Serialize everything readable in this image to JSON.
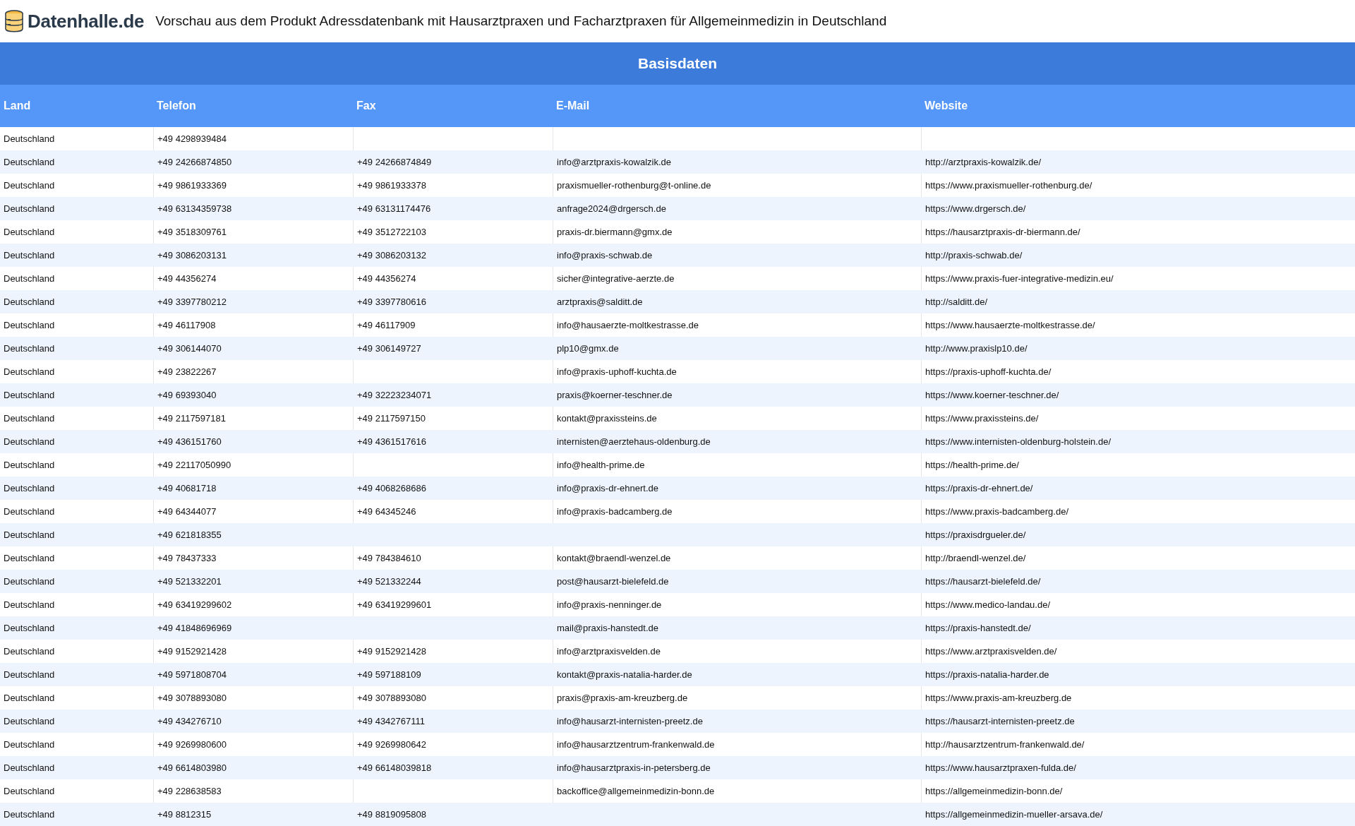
{
  "header": {
    "logo_text": "Datenhalle.de",
    "title": "Vorschau aus dem Produkt Adressdatenbank mit Hausarztpraxen und Facharztpraxen für Allgemeinmedizin in Deutschland"
  },
  "table": {
    "banner": "Basisdaten",
    "columns": [
      "Land",
      "Telefon",
      "Fax",
      "E-Mail",
      "Website"
    ],
    "rows": [
      {
        "land": "Deutschland",
        "telefon": "+49 4298939484"
      },
      {
        "land": "Deutschland",
        "telefon": "+49 24266874850",
        "fax": "+49 24266874849",
        "email": "info@arztpraxis-kowalzik.de",
        "website": "http://arztpraxis-kowalzik.de/"
      },
      {
        "land": "Deutschland",
        "telefon": "+49 9861933369",
        "fax": "+49 9861933378",
        "email": "praxismueller-rothenburg@t-online.de",
        "website": "https://www.praxismueller-rothenburg.de/"
      },
      {
        "land": "Deutschland",
        "telefon": "+49 63134359738",
        "fax": "+49 63131174476",
        "email": "anfrage2024@drgersch.de",
        "website": "https://www.drgersch.de/"
      },
      {
        "land": "Deutschland",
        "telefon": "+49 3518309761",
        "fax": "+49 3512722103",
        "email": "praxis-dr.biermann@gmx.de",
        "website": "https://hausarztpraxis-dr-biermann.de/"
      },
      {
        "land": "Deutschland",
        "telefon": "+49 3086203131",
        "fax": "+49 3086203132",
        "email": "info@praxis-schwab.de",
        "website": "http://praxis-schwab.de/"
      },
      {
        "land": "Deutschland",
        "telefon": "+49 44356274",
        "fax": "+49 44356274",
        "email": "sicher@integrative-aerzte.de",
        "website": "https://www.praxis-fuer-integrative-medizin.eu/"
      },
      {
        "land": "Deutschland",
        "telefon": "+49 3397780212",
        "fax": "+49 3397780616",
        "email": "arztpraxis@salditt.de",
        "website": "http://salditt.de/"
      },
      {
        "land": "Deutschland",
        "telefon": "+49 46117908",
        "fax": "+49 46117909",
        "email": "info@hausaerzte-moltkestrasse.de",
        "website": "https://www.hausaerzte-moltkestrasse.de/"
      },
      {
        "land": "Deutschland",
        "telefon": "+49 306144070",
        "fax": "+49 306149727",
        "email": "plp10@gmx.de",
        "website": "http://www.praxislp10.de/"
      },
      {
        "land": "Deutschland",
        "telefon": "+49 23822267",
        "email": "info@praxis-uphoff-kuchta.de",
        "website": "https://praxis-uphoff-kuchta.de/"
      },
      {
        "land": "Deutschland",
        "telefon": "+49 69393040",
        "fax": "+49 32223234071",
        "email": "praxis@koerner-teschner.de",
        "website": "https://www.koerner-teschner.de/"
      },
      {
        "land": "Deutschland",
        "telefon": "+49 2117597181",
        "fax": "+49 2117597150",
        "email": "kontakt@praxissteins.de",
        "website": "https://www.praxissteins.de/"
      },
      {
        "land": "Deutschland",
        "telefon": "+49 436151760",
        "fax": "+49 4361517616",
        "email": "internisten@aerztehaus-oldenburg.de",
        "website": "https://www.internisten-oldenburg-holstein.de/"
      },
      {
        "land": "Deutschland",
        "telefon": "+49 22117050990",
        "email": "info@health-prime.de",
        "website": "https://health-prime.de/"
      },
      {
        "land": "Deutschland",
        "telefon": "+49 40681718",
        "fax": "+49 4068268686",
        "email": "info@praxis-dr-ehnert.de",
        "website": "https://praxis-dr-ehnert.de/"
      },
      {
        "land": "Deutschland",
        "telefon": "+49 64344077",
        "fax": "+49 64345246",
        "email": "info@praxis-badcamberg.de",
        "website": "https://www.praxis-badcamberg.de/"
      },
      {
        "land": "Deutschland",
        "telefon": "+49 621818355",
        "website": "https://praxisdrgueler.de/"
      },
      {
        "land": "Deutschland",
        "telefon": "+49 78437333",
        "fax": "+49 784384610",
        "email": "kontakt@braendl-wenzel.de",
        "website": "http://braendl-wenzel.de/"
      },
      {
        "land": "Deutschland",
        "telefon": "+49 521332201",
        "fax": "+49 521332244",
        "email": "post@hausarzt-bielefeld.de",
        "website": "https://hausarzt-bielefeld.de/"
      },
      {
        "land": "Deutschland",
        "telefon": "+49 63419299602",
        "fax": "+49 63419299601",
        "email": "info@praxis-nenninger.de",
        "website": "https://www.medico-landau.de/"
      },
      {
        "land": "Deutschland",
        "telefon": "+49 41848696969",
        "email": "mail@praxis-hanstedt.de",
        "website": "https://praxis-hanstedt.de/"
      },
      {
        "land": "Deutschland",
        "telefon": "+49 9152921428",
        "fax": "+49 9152921428",
        "email": "info@arztpraxisvelden.de",
        "website": "https://www.arztpraxisvelden.de/"
      },
      {
        "land": "Deutschland",
        "telefon": "+49 5971808704",
        "fax": "+49 597188109",
        "email": "kontakt@praxis-natalia-harder.de",
        "website": "https://praxis-natalia-harder.de"
      },
      {
        "land": "Deutschland",
        "telefon": "+49 3078893080",
        "fax": "+49 3078893080",
        "email": "praxis@praxis-am-kreuzberg.de",
        "website": "https://www.praxis-am-kreuzberg.de"
      },
      {
        "land": "Deutschland",
        "telefon": "+49 434276710",
        "fax": "+49 4342767111",
        "email": "info@hausarzt-internisten-preetz.de",
        "website": "https://hausarzt-internisten-preetz.de"
      },
      {
        "land": "Deutschland",
        "telefon": "+49 9269980600",
        "fax": "+49 9269980642",
        "email": "info@hausarztzentrum-frankenwald.de",
        "website": "http://hausarztzentrum-frankenwald.de/"
      },
      {
        "land": "Deutschland",
        "telefon": "+49 6614803980",
        "fax": "+49 66148039818",
        "email": "info@hausarztpraxis-in-petersberg.de",
        "website": "https://www.hausarztpraxen-fulda.de/"
      },
      {
        "land": "Deutschland",
        "telefon": "+49 228638583",
        "email": "backoffice@allgemeinmedizin-bonn.de",
        "website": "https://allgemeinmedizin-bonn.de/"
      },
      {
        "land": "Deutschland",
        "telefon": "+49 8812315",
        "fax": "+49 8819095808",
        "website": "https://allgemeinmedizin-mueller-arsava.de/"
      }
    ]
  }
}
